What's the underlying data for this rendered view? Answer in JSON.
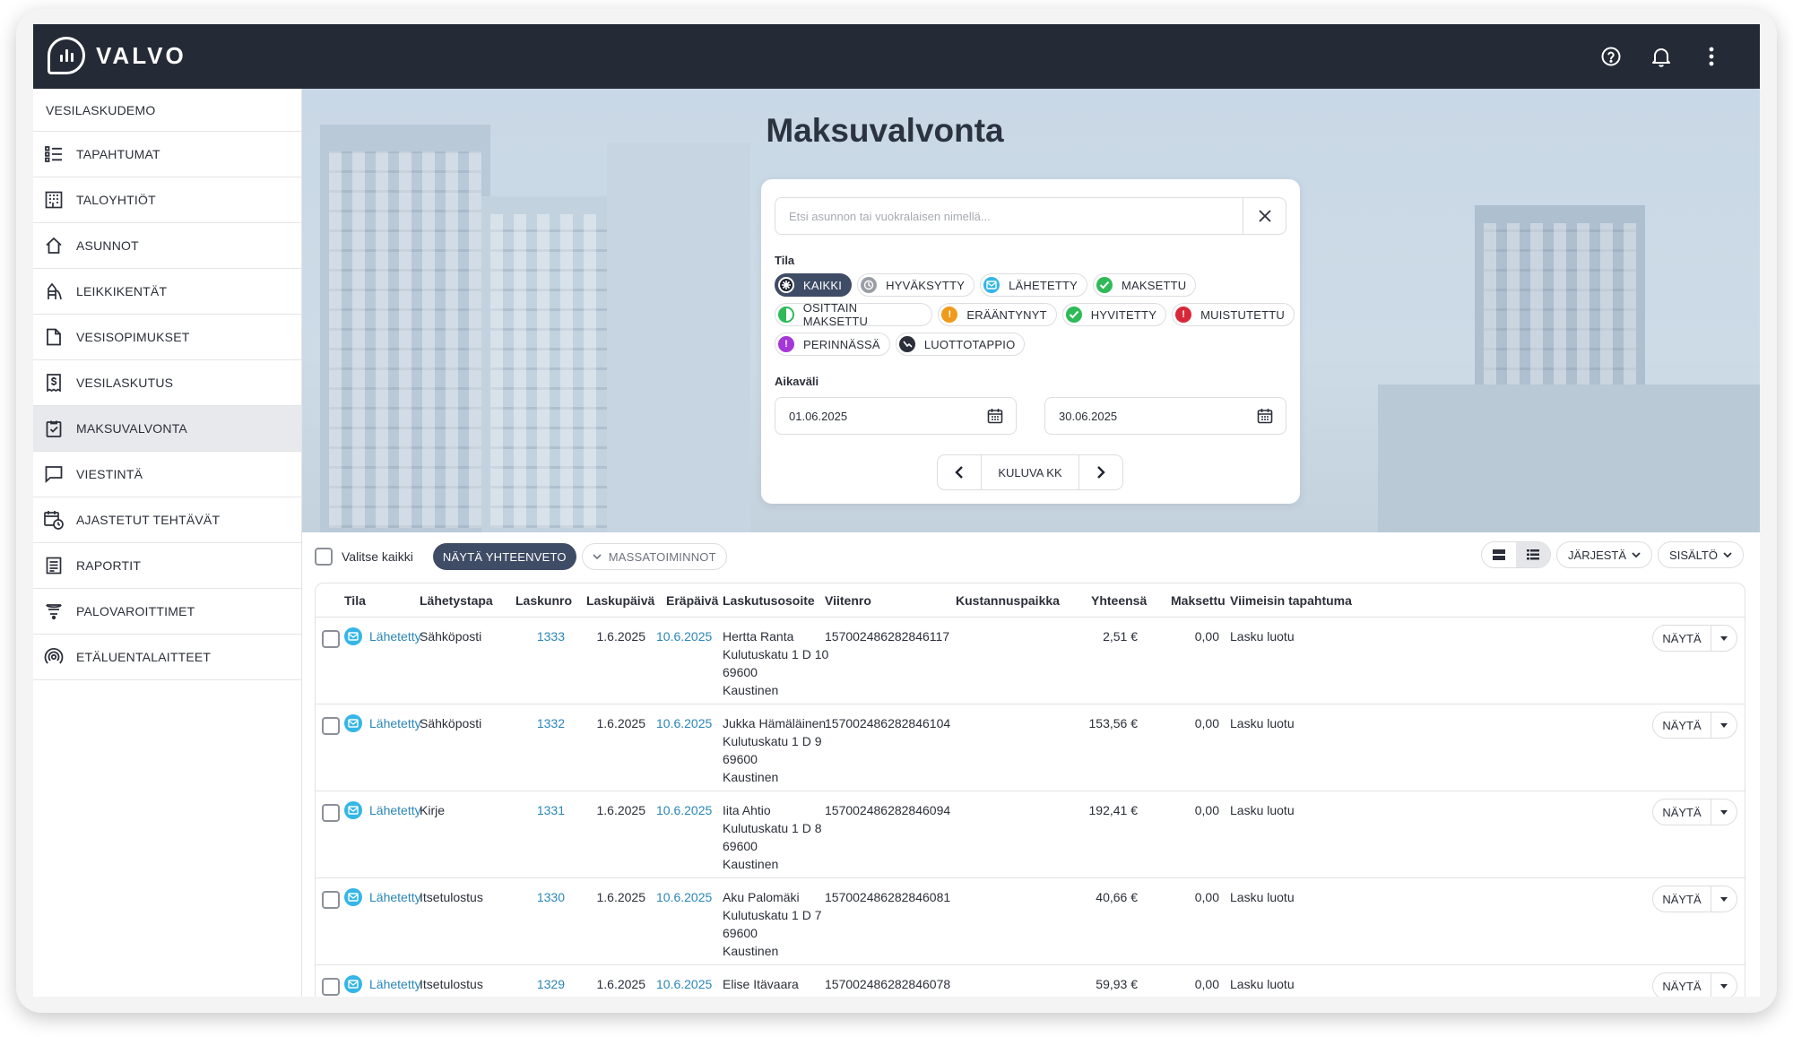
{
  "app": {
    "logo_text": "VALVO"
  },
  "topbar": {
    "icons": [
      "help-icon",
      "bell-icon",
      "more-vertical-icon"
    ]
  },
  "sidebar": {
    "org_name": "VESILASKUDEMO",
    "items": [
      {
        "label": "TAPAHTUMAT",
        "icon": "list-icon"
      },
      {
        "label": "TALOYHTIÖT",
        "icon": "building-icon"
      },
      {
        "label": "ASUNNOT",
        "icon": "house-icon"
      },
      {
        "label": "LEIKKIKENTÄT",
        "icon": "playground-icon"
      },
      {
        "label": "VESISOPIMUKSET",
        "icon": "document-icon"
      },
      {
        "label": "VESILASKUTUS",
        "icon": "invoice-icon"
      },
      {
        "label": "MAKSUVALVONTA",
        "icon": "clipboard-check-icon",
        "active": true
      },
      {
        "label": "VIESTINTÄ",
        "icon": "message-icon"
      },
      {
        "label": "AJASTETUT TEHTÄVÄT",
        "icon": "calendar-clock-icon"
      },
      {
        "label": "RAPORTIT",
        "icon": "report-icon"
      },
      {
        "label": "PALOVAROITTIMET",
        "icon": "smoke-alarm-icon"
      },
      {
        "label": "ETÄLUENTALAITTEET",
        "icon": "remote-reader-icon"
      }
    ]
  },
  "page": {
    "title": "Maksuvalvonta"
  },
  "filter": {
    "search_placeholder": "Etsi asunnon tai vuokralaisen nimellä...",
    "status_label": "Tila",
    "statuses": [
      {
        "label": "KAIKKI",
        "color": "#1e2330",
        "active": true
      },
      {
        "label": "HYVÄKSYTTY",
        "color": "#9a9ea6"
      },
      {
        "label": "LÄHETETTY",
        "color": "#35b6e6"
      },
      {
        "label": "MAKSETTU",
        "color": "#2fba58"
      },
      {
        "label": "OSITTAIN MAKSETTU",
        "color": "#2fba58"
      },
      {
        "label": "ERÄÄNTYNYT",
        "color": "#f09a1c"
      },
      {
        "label": "HYVITETTY",
        "color": "#2fba58"
      },
      {
        "label": "MUISTUTETTU",
        "color": "#d9273a"
      },
      {
        "label": "PERINNÄSSÄ",
        "color": "#a437d8"
      },
      {
        "label": "LUOTTOTAPPIO",
        "color": "#2b2f3a"
      }
    ],
    "range_label": "Aikaväli",
    "date_from": "01.06.2025",
    "date_to": "30.06.2025",
    "current_month": "KULUVA KK"
  },
  "toolbar": {
    "select_all": "Valitse kaikki",
    "summary_button": "NÄYTÄ YHTEENVETO",
    "mass_actions": "MASSATOIMINNOT",
    "sort": "JÄRJESTÄ",
    "content": "SISÄLTÖ"
  },
  "table": {
    "columns": [
      "Tila",
      "Lähetystapa",
      "Laskunro",
      "Laskupäivä",
      "Eräpäivä",
      "Laskutusosoite",
      "Viitenro",
      "Kustannuspaikka",
      "Yhteensä",
      "Maksettu",
      "Viimeisin tapahtuma"
    ],
    "row_button": "NÄYTÄ",
    "rows": [
      {
        "status": "Lähetetty",
        "method": "Sähköposti",
        "number": "1333",
        "date": "1.6.2025",
        "due": "10.6.2025",
        "name": "Hertta Ranta",
        "street": "Kulutuskatu 1 D 10",
        "zip": "69600",
        "city": "Kaustinen",
        "ref": "157002486282846117",
        "cost_center": "",
        "total": "2,51 €",
        "paid": "0,00",
        "event": "Lasku luotu"
      },
      {
        "status": "Lähetetty",
        "method": "Sähköposti",
        "number": "1332",
        "date": "1.6.2025",
        "due": "10.6.2025",
        "name": "Jukka Hämäläinen",
        "street": "Kulutuskatu 1 D 9",
        "zip": "69600",
        "city": "Kaustinen",
        "ref": "157002486282846104",
        "cost_center": "",
        "total": "153,56 €",
        "paid": "0,00",
        "event": "Lasku luotu"
      },
      {
        "status": "Lähetetty",
        "method": "Kirje",
        "number": "1331",
        "date": "1.6.2025",
        "due": "10.6.2025",
        "name": "Iita Ahtio",
        "street": "Kulutuskatu 1 D 8",
        "zip": "69600",
        "city": "Kaustinen",
        "ref": "157002486282846094",
        "cost_center": "",
        "total": "192,41 €",
        "paid": "0,00",
        "event": "Lasku luotu"
      },
      {
        "status": "Lähetetty",
        "method": "Itsetulostus",
        "number": "1330",
        "date": "1.6.2025",
        "due": "10.6.2025",
        "name": "Aku Palomäki",
        "street": "Kulutuskatu 1 D 7",
        "zip": "69600",
        "city": "Kaustinen",
        "ref": "157002486282846081",
        "cost_center": "",
        "total": "40,66 €",
        "paid": "0,00",
        "event": "Lasku luotu"
      },
      {
        "status": "Lähetetty",
        "method": "Itsetulostus",
        "number": "1329",
        "date": "1.6.2025",
        "due": "10.6.2025",
        "name": "Elise Itävaara",
        "street": "",
        "zip": "",
        "city": "",
        "ref": "157002486282846078",
        "cost_center": "",
        "total": "59,93 €",
        "paid": "0,00",
        "event": "Lasku luotu"
      }
    ]
  }
}
